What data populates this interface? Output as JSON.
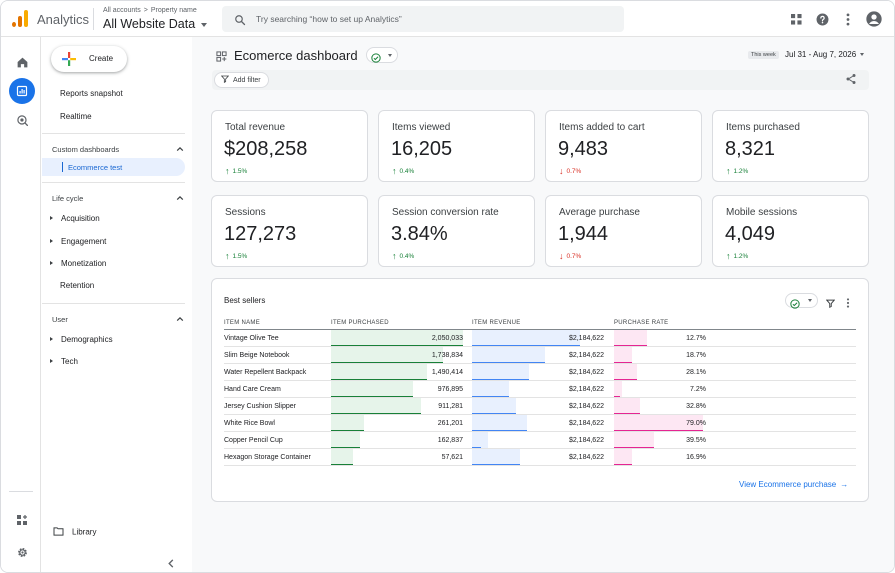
{
  "header": {
    "app_name": "Analytics",
    "breadcrumb": [
      "All accounts",
      "Property name"
    ],
    "breadcrumb_sep": ">",
    "property": "All Website Data",
    "search_placeholder": "Try searching “how to set up Analytics”"
  },
  "sidebar": {
    "create_label": "Create",
    "top_items": [
      "Reports snapshot",
      "Realtime"
    ],
    "custom_dashboards": {
      "heading": "Custom dashboards",
      "items": [
        "Ecommerce test"
      ]
    },
    "life_cycle": {
      "heading": "Life cycle",
      "items": [
        "Acquisition",
        "Engagement",
        "Monetization",
        "Retention"
      ]
    },
    "user": {
      "heading": "User",
      "items": [
        "Demographics",
        "Tech"
      ]
    },
    "library_label": "Library"
  },
  "dashboard": {
    "title": "Ecomerce dashboard",
    "date_badge": "This week",
    "date_range": "Jul 31 - Aug 7, 2026",
    "add_filter_label": "Add filter"
  },
  "kpis": [
    {
      "label": "Total revenue",
      "value": "$208,258",
      "change": "1.5%",
      "direction": "up"
    },
    {
      "label": "Items viewed",
      "value": "16,205",
      "change": "0.4%",
      "direction": "up"
    },
    {
      "label": "Items added to cart",
      "value": "9,483",
      "change": "0.7%",
      "direction": "down"
    },
    {
      "label": "Items purchased",
      "value": "8,321",
      "change": "1.2%",
      "direction": "up"
    },
    {
      "label": "Sessions",
      "value": "127,273",
      "change": "1.5%",
      "direction": "up"
    },
    {
      "label": "Session conversion rate",
      "value": "3.84%",
      "change": "0.4%",
      "direction": "up"
    },
    {
      "label": "Average purchase",
      "value": "1,944",
      "change": "0.7%",
      "direction": "down"
    },
    {
      "label": "Mobile sessions",
      "value": "4,049",
      "change": "1.2%",
      "direction": "up"
    }
  ],
  "best_sellers": {
    "title": "Best sellers",
    "columns": [
      "ITEM NAME",
      "ITEM PURCHASED",
      "ITEM REVENUE",
      "PURCHASE RATE"
    ],
    "rows": [
      {
        "name": "Vintage Olive Tee",
        "purchased": "2,050,033",
        "purchased_frac": 1.0,
        "revenue": "$2,184,622",
        "revenue_frac": 0.82,
        "rate": "12.7%",
        "rate_frac": 0.36
      },
      {
        "name": "Slim Beige Notebook",
        "purchased": "1,738,834",
        "purchased_frac": 0.85,
        "revenue": "$2,184,622",
        "revenue_frac": 0.55,
        "rate": "18.7%",
        "rate_frac": 0.2
      },
      {
        "name": "Water Repellent Backpack",
        "purchased": "1,490,414",
        "purchased_frac": 0.73,
        "revenue": "$2,184,622",
        "revenue_frac": 0.43,
        "rate": "28.1%",
        "rate_frac": 0.25
      },
      {
        "name": "Hand Care Cream",
        "purchased": "976,895",
        "purchased_frac": 0.62,
        "revenue": "$2,184,622",
        "revenue_frac": 0.28,
        "rate": "7.2%",
        "rate_frac": 0.07
      },
      {
        "name": "Jersey Cushion Slipper",
        "purchased": "911,281",
        "purchased_frac": 0.68,
        "revenue": "$2,184,622",
        "revenue_frac": 0.33,
        "rate": "32.8%",
        "rate_frac": 0.28
      },
      {
        "name": "White Rice Bowl",
        "purchased": "261,201",
        "purchased_frac": 0.25,
        "revenue": "$2,184,622",
        "revenue_frac": 0.42,
        "rate": "79.0%",
        "rate_frac": 0.97
      },
      {
        "name": "Copper Pencil Cup",
        "purchased": "162,837",
        "purchased_frac": 0.22,
        "revenue": "$2,184,622",
        "revenue_frac": 0.07,
        "rate": "39.5%",
        "rate_frac": 0.44
      },
      {
        "name": "Hexagon Storage Container",
        "purchased": "57,621",
        "purchased_frac": 0.17,
        "revenue": "$2,184,622",
        "revenue_frac": 0.36,
        "rate": "16.9%",
        "rate_frac": 0.2
      }
    ],
    "view_link": "View Ecommerce purchase"
  },
  "colors": {
    "accent": "#1a73e8",
    "purchased_bar": "#188038",
    "purchased_bg": "#e6f4ea",
    "revenue_bar": "#4285f4",
    "revenue_bg": "#e8f0fe",
    "rate_bar": "#e52592",
    "rate_bg": "#fde7f3"
  },
  "icons": {
    "rail": [
      "home-icon",
      "reports-icon",
      "explore-icon",
      "customize-icon",
      "settings-icon"
    ],
    "top": [
      "apps-grid-icon",
      "help-icon",
      "more-vert-icon",
      "account-icon"
    ]
  }
}
